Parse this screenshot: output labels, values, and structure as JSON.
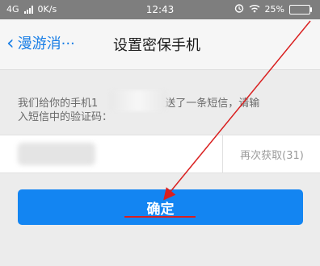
{
  "status_bar": {
    "network": "4G",
    "speed": "0K/s",
    "time": "12:43",
    "battery": "25%"
  },
  "nav": {
    "back_label": "漫游消···",
    "title": "设置密保手机"
  },
  "message": {
    "line1_prefix": "我们给你的手机1",
    "line1_suffix": "发送了一条短信，请输",
    "line2": "入短信中的验证码："
  },
  "code": {
    "resend_label": "再次获取(31)"
  },
  "confirm": {
    "label": "确定"
  },
  "annotation": {
    "color": "#d91f1f"
  }
}
